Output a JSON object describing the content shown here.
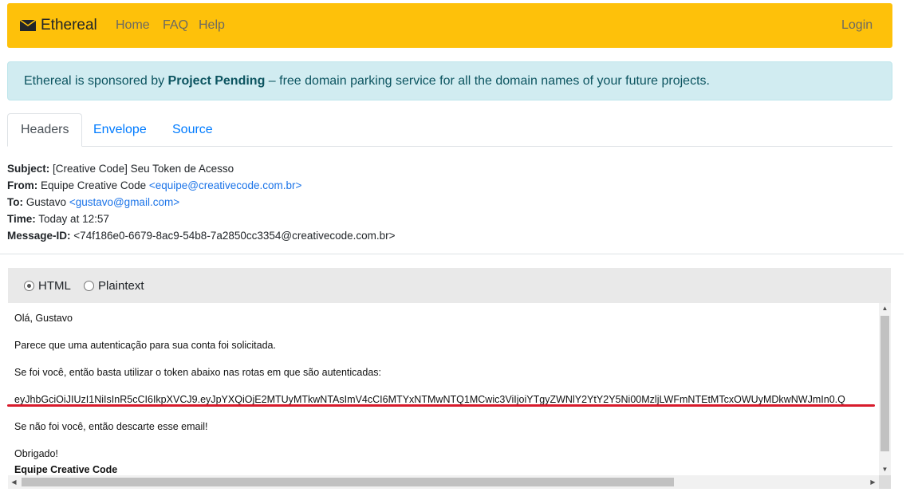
{
  "navbar": {
    "brand": "Ethereal",
    "links": [
      "Home",
      "FAQ",
      "Help"
    ],
    "login": "Login",
    "bg_color": "#fec10a"
  },
  "alert": {
    "prefix": "Ethereal is sponsored by ",
    "sponsor": "Project Pending",
    "suffix": " – free domain parking service for all the domain names of your future projects."
  },
  "tabs": [
    "Headers",
    "Envelope",
    "Source"
  ],
  "headers": {
    "subject_label": "Subject:",
    "subject": "[Creative Code] Seu Token de Acesso",
    "from_label": "From:",
    "from_name": "Equipe Creative Code",
    "from_email": "<equipe@creativecode.com.br>",
    "to_label": "To:",
    "to_name": "Gustavo",
    "to_email": "<gustavo@gmail.com>",
    "time_label": "Time:",
    "time": "Today at 12:57",
    "message_id_label": "Message-ID:",
    "message_id": "<74f186e0-6679-8ac9-54b8-7a2850cc3354@creativecode.com.br>"
  },
  "format": {
    "options": [
      "HTML",
      "Plaintext"
    ],
    "selected": "HTML"
  },
  "message": {
    "greeting": "Olá, Gustavo",
    "line1": "Parece que uma autenticação para sua conta foi solicitada.",
    "line2": "Se foi você, então basta utilizar o token abaixo nas rotas em que são autenticadas:",
    "token": "eyJhbGciOiJIUzI1NiIsInR5cCI6IkpXVCJ9.eyJpYXQiOjE2MTUyMTkwNTAsImV4cCI6MTYxNTMwNTQ1MCwic3ViIjoiYTgyZWNlY2YtY2Y5Ni00MzljLWFmNTEtMTcxOWUyMDkwNWJmIn0.Q",
    "line3": "Se não foi você, então descarte esse email!",
    "thanks": "Obrigado!",
    "signature": "Equipe Creative Code"
  },
  "colors": {
    "link": "#1a73e8",
    "highlight_underline": "#d81b2c"
  }
}
